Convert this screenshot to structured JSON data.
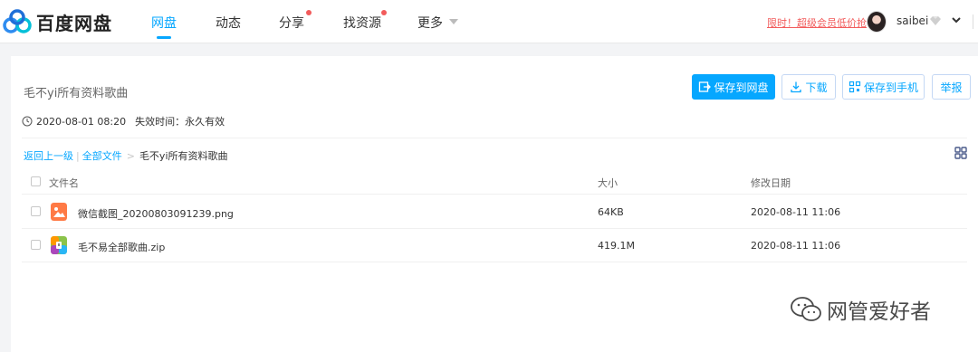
{
  "app": {
    "logo_text": "百度网盘"
  },
  "nav": {
    "items": [
      {
        "label": "网盘",
        "active": true
      },
      {
        "label": "动态"
      },
      {
        "label": "分享",
        "badge": true
      },
      {
        "label": "找资源",
        "badge": true
      },
      {
        "label": "更多"
      }
    ]
  },
  "header_right": {
    "promo": "限时！超级会员低价抢",
    "username": "saibei"
  },
  "share": {
    "title": "毛不yi所有资料歌曲",
    "date": "2020-08-01 08:20",
    "expiry": "失效时间：永久有效"
  },
  "actions": {
    "save_disk": "保存到网盘",
    "download": "下载",
    "save_phone": "保存到手机",
    "report": "举报"
  },
  "breadcrumb": {
    "back": "返回上一级",
    "all_files": "全部文件",
    "current": "毛不yi所有资料歌曲"
  },
  "table": {
    "headers": {
      "name": "文件名",
      "size": "大小",
      "date": "修改日期"
    },
    "rows": [
      {
        "name": "微信截图_20200803091239.png",
        "size": "64KB",
        "date": "2020-08-11 11:06",
        "icon": "image-file-icon"
      },
      {
        "name": "毛不易全部歌曲.zip",
        "size": "419.1M",
        "date": "2020-08-11 11:06",
        "icon": "zip-file-icon"
      }
    ]
  },
  "watermark": {
    "text": "网管爱好者"
  },
  "colors": {
    "accent": "#06a7ff",
    "badge": "#f25b5b",
    "image_icon": "#ff7a45"
  }
}
